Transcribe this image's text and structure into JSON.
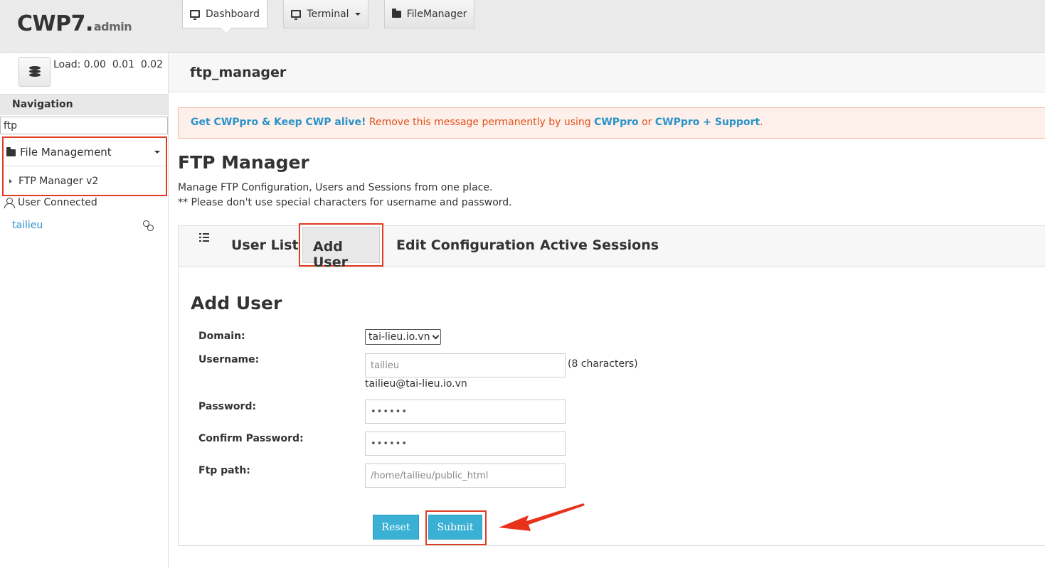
{
  "header": {
    "logo_main": "CWP7.",
    "logo_sub": "admin",
    "buttons": [
      {
        "label": "Dashboard",
        "icon": "monitor-icon",
        "active": true
      },
      {
        "label": "Terminal",
        "icon": "monitor-icon",
        "active": false
      },
      {
        "label": "FileManager",
        "icon": "folder-icon",
        "active": false
      }
    ]
  },
  "sidebar": {
    "load_text": "Load: 0.00  0.01  0.02",
    "nav_title": "Navigation",
    "search_value": "ftp",
    "section_label": "File Management",
    "section_item": "FTP Manager v2",
    "user_connected_label": "User Connected",
    "user_name": "tailieu"
  },
  "page": {
    "breadcrumb": "ftp_manager",
    "alert": {
      "lead": "Get CWPpro & Keep CWP alive!",
      "middle": " Remove this message permanently by using ",
      "link1": "CWPpro",
      "or": " or ",
      "link2": "CWPpro + Support",
      "end": "."
    },
    "title": "FTP Manager",
    "desc_line1": "Manage FTP Configuration, Users and Sessions from one place.",
    "desc_line2": "** Please don't use special characters for username and password."
  },
  "tabs": [
    {
      "label": "User List"
    },
    {
      "label": "Add User"
    },
    {
      "label": "Edit Configuration"
    },
    {
      "label": "Active Sessions"
    }
  ],
  "form": {
    "title": "Add User",
    "domain_label": "Domain:",
    "domain_value": "tai-lieu.io.vn",
    "username_label": "Username:",
    "username_value": "tailieu",
    "username_note": "(8 characters)",
    "username_email": "tailieu@tai-lieu.io.vn",
    "password_label": "Password:",
    "password_value": "••••••",
    "confirm_label": "Confirm Password:",
    "confirm_value": "••••••",
    "path_label": "Ftp path:",
    "path_value": "/home/tailieu/public_html",
    "reset_label": "Reset",
    "submit_label": "Submit"
  },
  "colors": {
    "accent": "#2a93c9",
    "highlight": "#e03c24",
    "button": "#3ab0d4",
    "alert_text": "#e0521d"
  }
}
